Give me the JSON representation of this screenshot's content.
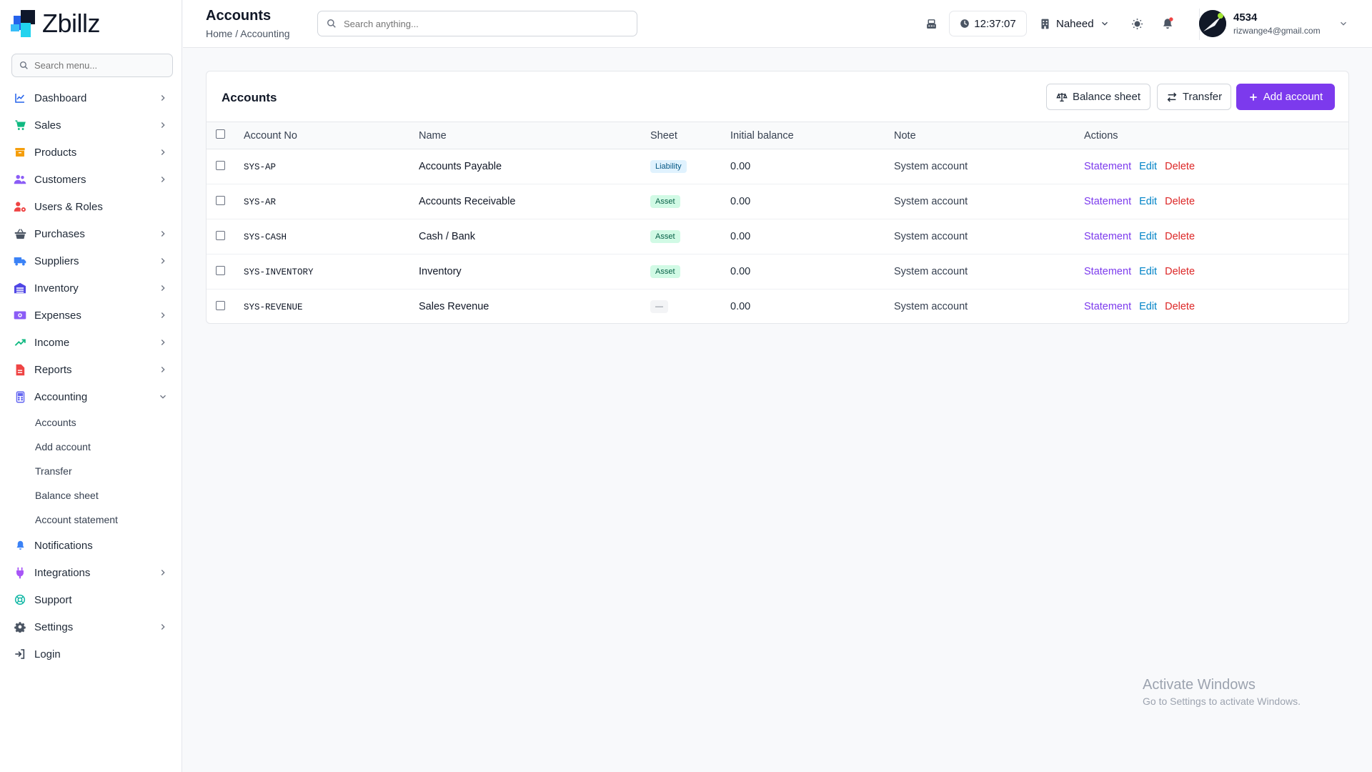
{
  "brand": {
    "name": "Zbillz"
  },
  "sidebar": {
    "search_placeholder": "Search menu...",
    "items": [
      {
        "label": "Dashboard",
        "icon": "chart-line-icon",
        "color": "#2563eb",
        "chevron": "right"
      },
      {
        "label": "Sales",
        "icon": "cart-icon",
        "color": "#10b981",
        "chevron": "right"
      },
      {
        "label": "Products",
        "icon": "box-icon",
        "color": "#f59e0b",
        "chevron": "right"
      },
      {
        "label": "Customers",
        "icon": "users-icon",
        "color": "#8b5cf6",
        "chevron": "right"
      },
      {
        "label": "Users & Roles",
        "icon": "user-cog-icon",
        "color": "#ef4444",
        "chevron": "none"
      },
      {
        "label": "Purchases",
        "icon": "basket-icon",
        "color": "#4b5563",
        "chevron": "right"
      },
      {
        "label": "Suppliers",
        "icon": "truck-icon",
        "color": "#3b82f6",
        "chevron": "right"
      },
      {
        "label": "Inventory",
        "icon": "warehouse-icon",
        "color": "#4f46e5",
        "chevron": "right"
      },
      {
        "label": "Expenses",
        "icon": "money-icon",
        "color": "#8b5cf6",
        "chevron": "right"
      },
      {
        "label": "Income",
        "icon": "trend-up-icon",
        "color": "#10b981",
        "chevron": "right"
      },
      {
        "label": "Reports",
        "icon": "file-icon",
        "color": "#ef4444",
        "chevron": "right"
      },
      {
        "label": "Accounting",
        "icon": "calculator-icon",
        "color": "#6366f1",
        "chevron": "down"
      }
    ],
    "accounting_sub": [
      "Accounts",
      "Add account",
      "Transfer",
      "Balance sheet",
      "Account statement"
    ],
    "bottom_items": [
      {
        "label": "Notifications",
        "icon": "bell-icon",
        "color": "#3b82f6",
        "chevron": "none"
      },
      {
        "label": "Integrations",
        "icon": "plug-icon",
        "color": "#a855f7",
        "chevron": "right"
      },
      {
        "label": "Support",
        "icon": "lifebuoy-icon",
        "color": "#14b8a6",
        "chevron": "none"
      },
      {
        "label": "Settings",
        "icon": "gear-icon",
        "color": "#4b5563",
        "chevron": "right"
      },
      {
        "label": "Login",
        "icon": "login-icon",
        "color": "#374151",
        "chevron": "none"
      }
    ]
  },
  "header": {
    "title": "Accounts",
    "breadcrumb": "Home / Accounting",
    "search_placeholder": "Search anything...",
    "time": "12:37:07",
    "store": "Naheed",
    "user_name": "4534",
    "user_email": "rizwange4@gmail.com"
  },
  "card": {
    "title": "Accounts",
    "btn_balance": "Balance sheet",
    "btn_transfer": "Transfer",
    "btn_add": "Add account"
  },
  "table": {
    "headers": [
      "Account No",
      "Name",
      "Sheet",
      "Initial balance",
      "Note",
      "Actions"
    ],
    "rows": [
      {
        "no": "SYS-AP",
        "name": "Accounts Payable",
        "sheet": "Liability",
        "balance": "0.00",
        "note": "System account"
      },
      {
        "no": "SYS-AR",
        "name": "Accounts Receivable",
        "sheet": "Asset",
        "balance": "0.00",
        "note": "System account"
      },
      {
        "no": "SYS-CASH",
        "name": "Cash / Bank",
        "sheet": "Asset",
        "balance": "0.00",
        "note": "System account"
      },
      {
        "no": "SYS-INVENTORY",
        "name": "Inventory",
        "sheet": "Asset",
        "balance": "0.00",
        "note": "System account"
      },
      {
        "no": "SYS-REVENUE",
        "name": "Sales Revenue",
        "sheet": "—",
        "balance": "0.00",
        "note": "System account"
      }
    ],
    "actions": {
      "statement": "Statement",
      "edit": "Edit",
      "delete": "Delete"
    }
  },
  "badge_styles": {
    "Liability": {
      "bg": "#e0f2fe",
      "fg": "#075985"
    },
    "Asset": {
      "bg": "#d1fae5",
      "fg": "#065f46"
    },
    "—": {
      "bg": "#f3f4f6",
      "fg": "#6b7280"
    }
  },
  "colors": {
    "accent": "#7c3aed",
    "statement": "#7c3aed",
    "edit": "#0284c7",
    "delete": "#dc2626"
  },
  "watermark": {
    "line1": "Activate Windows",
    "line2": "Go to Settings to activate Windows."
  }
}
